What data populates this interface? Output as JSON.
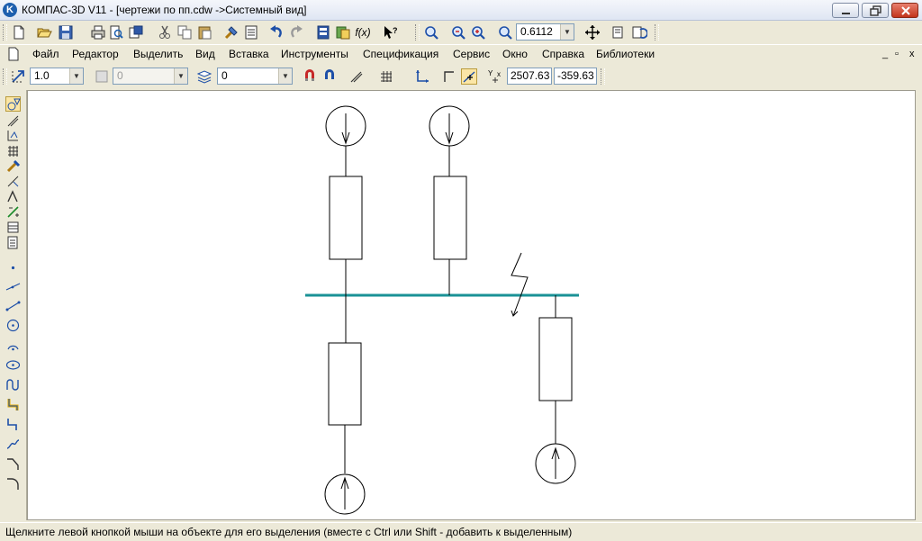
{
  "window": {
    "title": "КОМПАС-3D V11 - [чертежи по пп.cdw ->Системный вид]",
    "logo": "K"
  },
  "toolbar": {
    "zoom_value": "0.6112",
    "function_label": "f(x)"
  },
  "menu": {
    "items": [
      "Файл",
      "Редактор",
      "Выделить",
      "Вид",
      "Вставка",
      "Инструменты",
      "Спецификация",
      "Сервис",
      "Окно",
      "Справка",
      "Библиотеки"
    ],
    "mdi_controls": [
      "_",
      "▫",
      "x"
    ]
  },
  "current_state": {
    "scale": "1.0",
    "layer_state": "0",
    "layer": "0",
    "coord_x": "2507.63",
    "coord_y": "-359.63"
  },
  "status": {
    "message": "Щелкните левой кнопкой мыши на объекте для его выделения (вместе с Ctrl или Shift - добавить к выделенным)"
  },
  "colors": {
    "bus": "#1a9296",
    "drawing": "#000000",
    "canvas": "#ffffff",
    "panel": "#ece9d8"
  },
  "icons": {
    "toolbar_row1": [
      "new-icon",
      "open-icon",
      "save-icon",
      "print-icon",
      "preview-icon",
      "cut-icon",
      "copy-icon",
      "paste-icon",
      "properties-icon",
      "undo-icon",
      "redo-icon",
      "zoom-icon",
      "zoom-window-icon",
      "pan-icon"
    ],
    "vertical": [
      "geometry-icon",
      "dimensions-icon",
      "designations-icon",
      "edit-icon",
      "parametrize-icon",
      "measure-icon",
      "select-icon",
      "spec-icon",
      "reports-icon",
      "point-icon",
      "line-icon",
      "segment-icon",
      "circle-icon",
      "arc-icon",
      "ellipse-icon",
      "spline-icon",
      "hatch-icon",
      "polyline-icon",
      "curve-icon",
      "chamfer-icon",
      "fillet-icon"
    ]
  }
}
